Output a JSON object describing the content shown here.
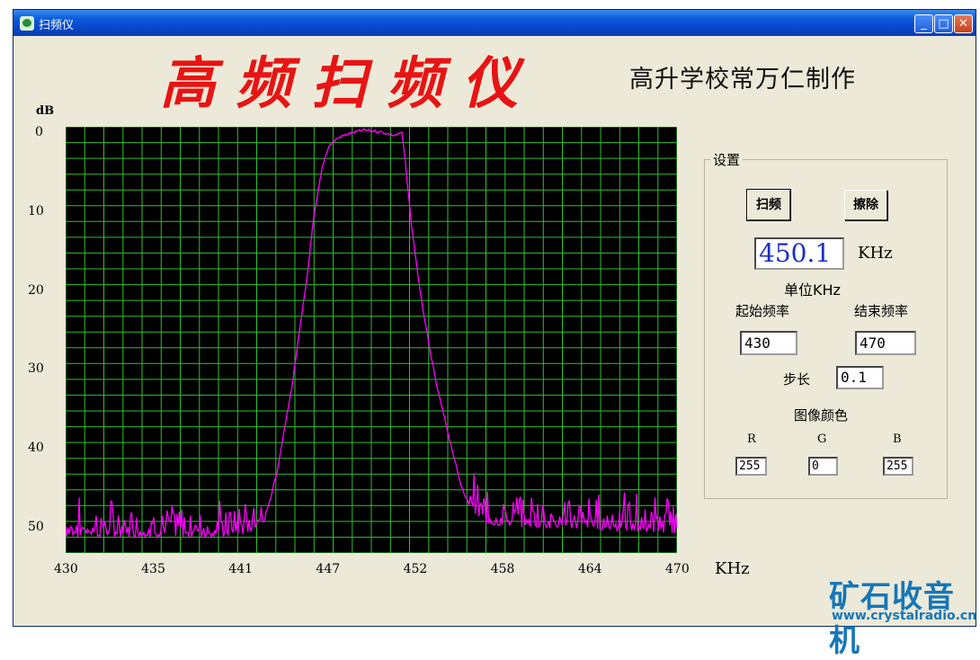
{
  "window": {
    "title": "扫频仪"
  },
  "header": {
    "main_title": "高频扫频仪",
    "subtitle": "高升学校常万仁制作"
  },
  "settings": {
    "group_title": "设置",
    "sweep_button": "扫频",
    "clear_button": "擦除",
    "current_freq": "450.1",
    "current_freq_unit": "KHz",
    "unit_note": "单位KHz",
    "start_label": "起始频率",
    "end_label": "结束频率",
    "start_value": "430",
    "end_value": "470",
    "step_label": "步长",
    "step_value": "0.1",
    "color_label": "图像颜色",
    "r_label": "R",
    "g_label": "G",
    "b_label": "B",
    "r_value": "255",
    "g_value": "0",
    "b_value": "255"
  },
  "watermark": {
    "cn": "矿石收音机",
    "url": "www.crystalradio.cn"
  },
  "colors": {
    "plot_bg": "#000000",
    "grid": "#2fbf2f",
    "trace": "#ff00ff",
    "title_red": "#e81414"
  },
  "chart_data": {
    "type": "line",
    "xlabel": "KHz",
    "ylabel": "dB",
    "xlim": [
      430,
      470
    ],
    "ylim": [
      0,
      54
    ],
    "y_inverted": true,
    "grid": true,
    "x_tick_labels": [
      "430",
      "435",
      "441",
      "447",
      "452",
      "458",
      "464",
      "470"
    ],
    "y_tick_labels": [
      "0",
      "10",
      "20",
      "30",
      "40",
      "50"
    ],
    "y_tick_values": [
      0,
      10,
      20,
      30,
      40,
      50
    ],
    "series": [
      {
        "color": "#ff00ff",
        "x": [
          430,
          440.8,
          442.0,
          443.0,
          443.8,
          444.8,
          445.3,
          445.8,
          446.2,
          446.8,
          447.2,
          447.8,
          448.5,
          449.5,
          450.5,
          451.5,
          452.0,
          452.2,
          452.6,
          453.2,
          453.8,
          454.3,
          454.8,
          455.3,
          455.8,
          456.3,
          456.8,
          457.3,
          470
        ],
        "y": [
          52,
          52,
          51.5,
          50,
          44,
          33,
          26,
          19,
          12,
          5,
          2.5,
          1.4,
          0.9,
          0.4,
          0.6,
          1.1,
          0.8,
          4,
          12,
          21,
          28,
          33,
          37,
          41,
          45,
          47.5,
          49,
          50.5,
          51.5
        ]
      }
    ]
  }
}
